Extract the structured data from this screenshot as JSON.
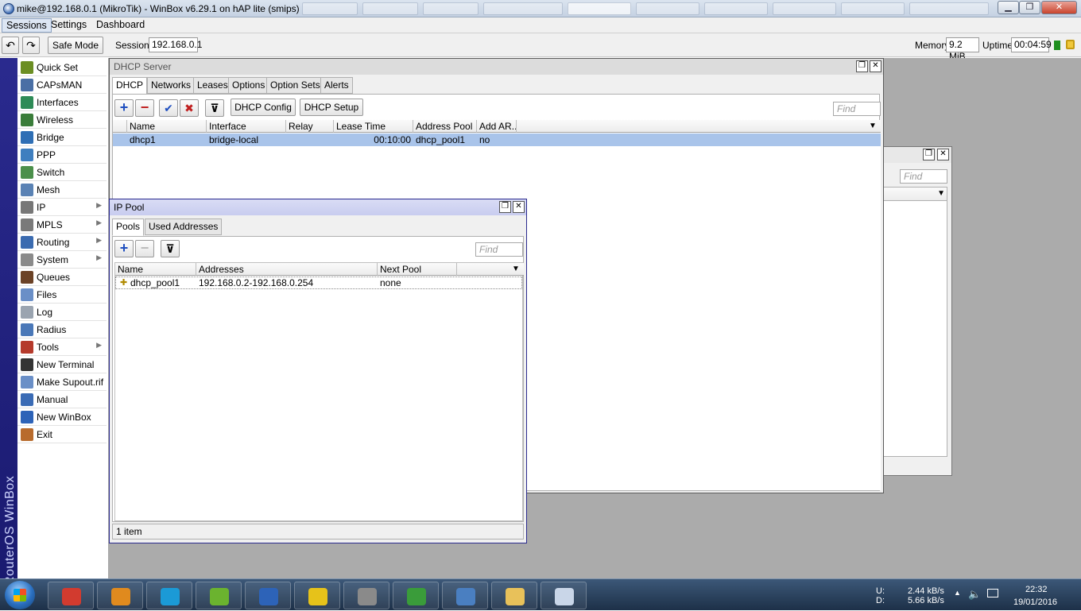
{
  "window": {
    "title": "mike@192.168.0.1 (MikroTik) - WinBox v6.29.1 on hAP lite (smips)",
    "minimize": "▁",
    "maximize": "❐",
    "close": "✕"
  },
  "menu": [
    "Sessions",
    "Settings",
    "Dashboard"
  ],
  "toolbar": {
    "undo": "↶",
    "redo": "↷",
    "safe_mode": "Safe Mode",
    "session_label": "Session:",
    "session_value": "192.168.0.1",
    "memory_label": "Memory:",
    "memory_value": "9.2 MiB",
    "uptime_label": "Uptime:",
    "uptime_value": "00:04:59"
  },
  "brand": "RouterOS WinBox",
  "sidebar": [
    {
      "label": "Quick Set",
      "icon": "wand-icon",
      "color": "#6b8e23"
    },
    {
      "label": "CAPsMAN",
      "icon": "antenna-icon",
      "color": "#4a6fa5"
    },
    {
      "label": "Interfaces",
      "icon": "interfaces-icon",
      "color": "#2e8b57"
    },
    {
      "label": "Wireless",
      "icon": "wireless-icon",
      "color": "#3a7d3a"
    },
    {
      "label": "Bridge",
      "icon": "bridge-icon",
      "color": "#2f6fb5"
    },
    {
      "label": "PPP",
      "icon": "ppp-icon",
      "color": "#3f7fbf"
    },
    {
      "label": "Switch",
      "icon": "switch-icon",
      "color": "#4b8f4b"
    },
    {
      "label": "Mesh",
      "icon": "mesh-icon",
      "color": "#5a82b4"
    },
    {
      "label": "IP",
      "icon": "ip-icon",
      "color": "#777777",
      "submenu": true
    },
    {
      "label": "MPLS",
      "icon": "mpls-icon",
      "color": "#7a7a7a",
      "submenu": true
    },
    {
      "label": "Routing",
      "icon": "routing-icon",
      "color": "#3b6bb0",
      "submenu": true
    },
    {
      "label": "System",
      "icon": "gear-icon",
      "color": "#8a8a8a",
      "submenu": true
    },
    {
      "label": "Queues",
      "icon": "queues-icon",
      "color": "#6b4226"
    },
    {
      "label": "Files",
      "icon": "folder-icon",
      "color": "#6a8fc7"
    },
    {
      "label": "Log",
      "icon": "log-icon",
      "color": "#9aa4b0"
    },
    {
      "label": "Radius",
      "icon": "radius-icon",
      "color": "#4a78b8"
    },
    {
      "label": "Tools",
      "icon": "tools-icon",
      "color": "#b53a2b",
      "submenu": true
    },
    {
      "label": "New Terminal",
      "icon": "terminal-icon",
      "color": "#333333"
    },
    {
      "label": "Make Supout.rif",
      "icon": "document-icon",
      "color": "#6a8fc7"
    },
    {
      "label": "Manual",
      "icon": "manual-icon",
      "color": "#3a6bb5"
    },
    {
      "label": "New WinBox",
      "icon": "winbox-icon",
      "color": "#2d63b8"
    },
    {
      "label": "Exit",
      "icon": "exit-icon",
      "color": "#b86b2d"
    }
  ],
  "dhcp_server": {
    "title": "DHCP Server",
    "tabs": [
      "DHCP",
      "Networks",
      "Leases",
      "Options",
      "Option Sets",
      "Alerts"
    ],
    "buttons": {
      "add": "+",
      "remove": "−",
      "enable": "✔",
      "disable": "✖",
      "filter": "⊽",
      "dhcp_config": "DHCP Config",
      "dhcp_setup": "DHCP Setup"
    },
    "find_placeholder": "Find",
    "columns": [
      "Name",
      "Interface",
      "Relay",
      "Lease Time",
      "Address Pool",
      "Add AR..."
    ],
    "rows": [
      {
        "name": "dhcp1",
        "interface": "bridge-local",
        "relay": "",
        "lease_time": "00:10:00",
        "address_pool": "dhcp_pool1",
        "add_arp": "no"
      }
    ]
  },
  "background_window": {
    "find_placeholder": "Find"
  },
  "ip_pool": {
    "title": "IP Pool",
    "tabs": [
      "Pools",
      "Used Addresses"
    ],
    "buttons": {
      "add": "+",
      "remove": "−",
      "filter": "⊽"
    },
    "find_placeholder": "Find",
    "columns": [
      "Name",
      "Addresses",
      "Next Pool"
    ],
    "rows": [
      {
        "name": "dhcp_pool1",
        "addresses": "192.168.0.2-192.168.0.254",
        "next_pool": "none"
      }
    ],
    "status": "1 item"
  },
  "taskbar": {
    "apps": [
      {
        "name": "chrome",
        "color": "#d23b2f"
      },
      {
        "name": "media-player",
        "color": "#e08a1e"
      },
      {
        "name": "skype",
        "color": "#1b9ad6"
      },
      {
        "name": "utorrent",
        "color": "#6bb32f"
      },
      {
        "name": "winbox",
        "color": "#2d63b8"
      },
      {
        "name": "game-launcher",
        "color": "#e6c21a"
      },
      {
        "name": "game",
        "color": "#8a8a8a"
      },
      {
        "name": "download-manager",
        "color": "#3a9c3a"
      },
      {
        "name": "network-tool",
        "color": "#4a7fc1"
      },
      {
        "name": "file-explorer",
        "color": "#e8c15a"
      },
      {
        "name": "document-app",
        "color": "#c9d6e8"
      }
    ],
    "net_up_label": "U:",
    "net_up": "2.44 kB/s",
    "net_down_label": "D:",
    "net_down": "5.66 kB/s",
    "time": "22:32",
    "date": "19/01/2016"
  }
}
